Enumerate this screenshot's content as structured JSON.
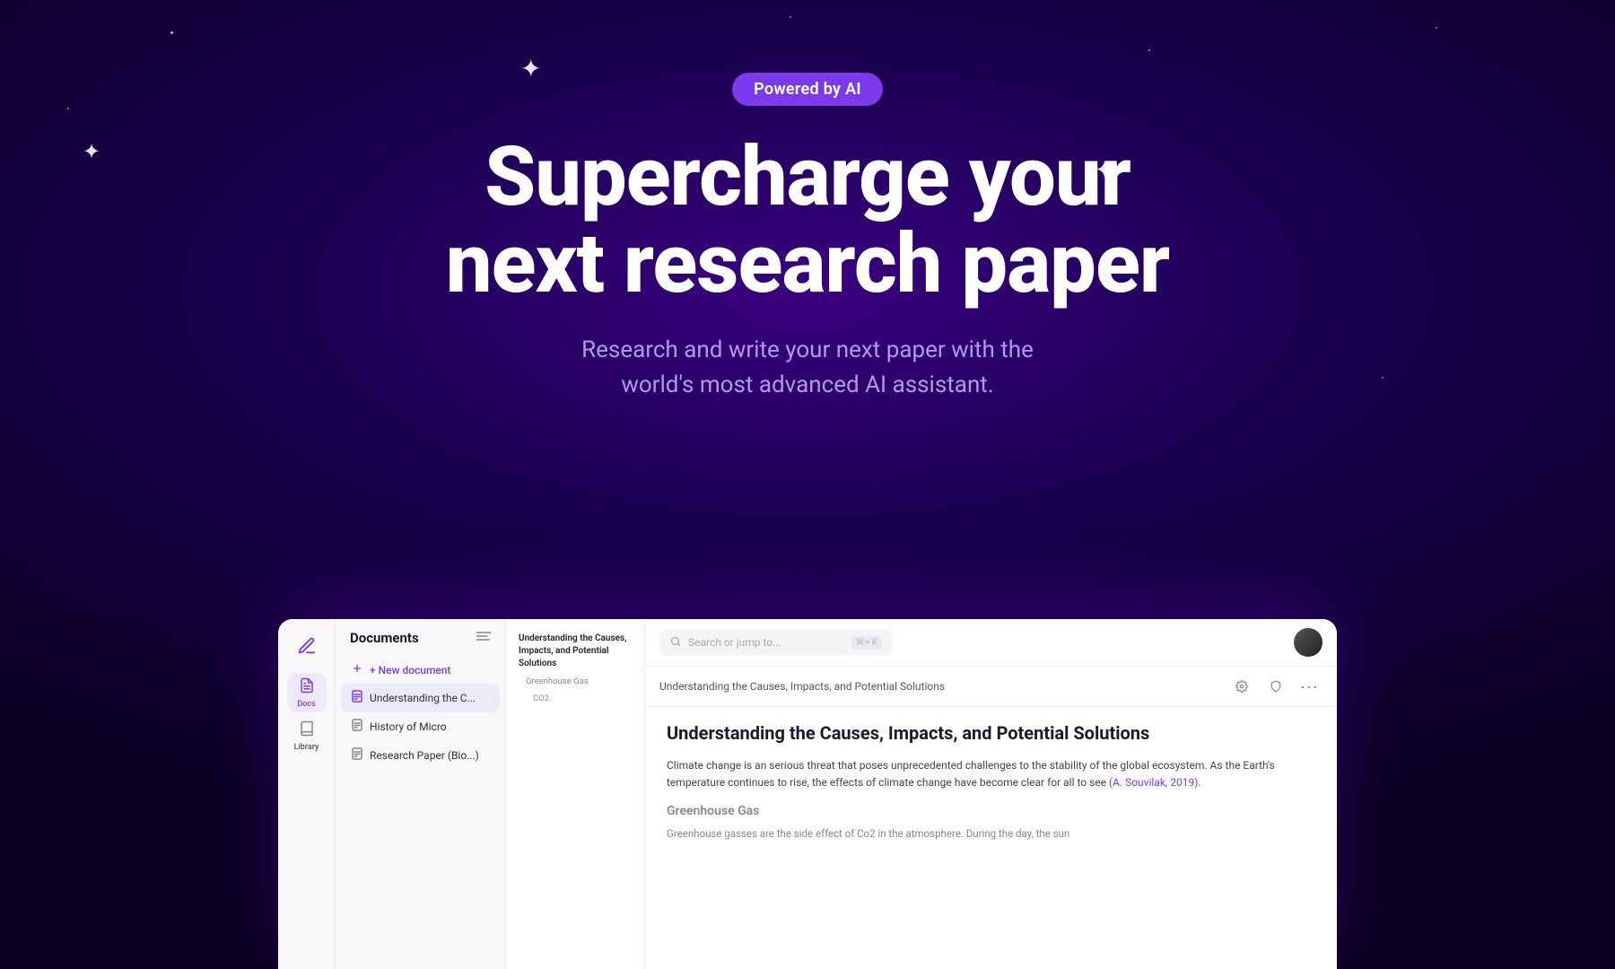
{
  "background": {
    "color_deep": "#0a0020",
    "color_mid": "#3a0080"
  },
  "badge": {
    "label": "Powered by AI"
  },
  "hero": {
    "title_line1": "Supercharge your",
    "title_line2": "next research paper",
    "subtitle": "Research and write your next paper with the\nworld's most advanced AI assistant."
  },
  "app": {
    "sidebar_icons": [
      {
        "id": "docs",
        "label": "Docs",
        "active": true
      },
      {
        "id": "library",
        "label": "Library",
        "active": false
      }
    ],
    "documents_panel": {
      "title": "Documents",
      "new_document_label": "+ New document",
      "items": [
        {
          "name": "Understanding the C...",
          "active": true
        },
        {
          "name": "History of Micro",
          "active": false
        },
        {
          "name": "Research Paper (Bio...)",
          "active": false
        }
      ]
    },
    "outline": {
      "items": [
        {
          "text": "Understanding the Causes, Impacts, and Potential Solutions",
          "level": "main"
        },
        {
          "text": "Greenhouse Gas",
          "level": "sub"
        },
        {
          "text": "CO2",
          "level": "sub2"
        }
      ]
    },
    "topbar": {
      "search_placeholder": "Search or jump to...",
      "search_shortcut": "⌘+ K"
    },
    "breadcrumb": {
      "text": "Understanding the Causes, Impacts, and Potential Solutions"
    },
    "document": {
      "title": "Understanding the Causes, Impacts, and Potential Solutions",
      "body1": "Climate change is an serious threat that poses unprecedented challenges to the stability of the global ecosystem. As the Earth's temperature continues to rise, the effects of climate change have become clear for all to see ",
      "citation": "(A. Souvilak, 2019)",
      "body1_end": ".",
      "section_title": "Greenhouse Gas",
      "section_body": "Greenhouse gasses are the side effect of Co2 in the atmosphere. During the day, the sun"
    }
  },
  "icons": {
    "pen": "✒",
    "docs": "📄",
    "library": "📚",
    "search": "🔍",
    "gear": "⚙",
    "shield": "🛡",
    "more": "•••",
    "file": "📄",
    "new_file": "➕",
    "menu": "≡",
    "sparkles": [
      "✦",
      "✦",
      "✦",
      "✦"
    ]
  }
}
